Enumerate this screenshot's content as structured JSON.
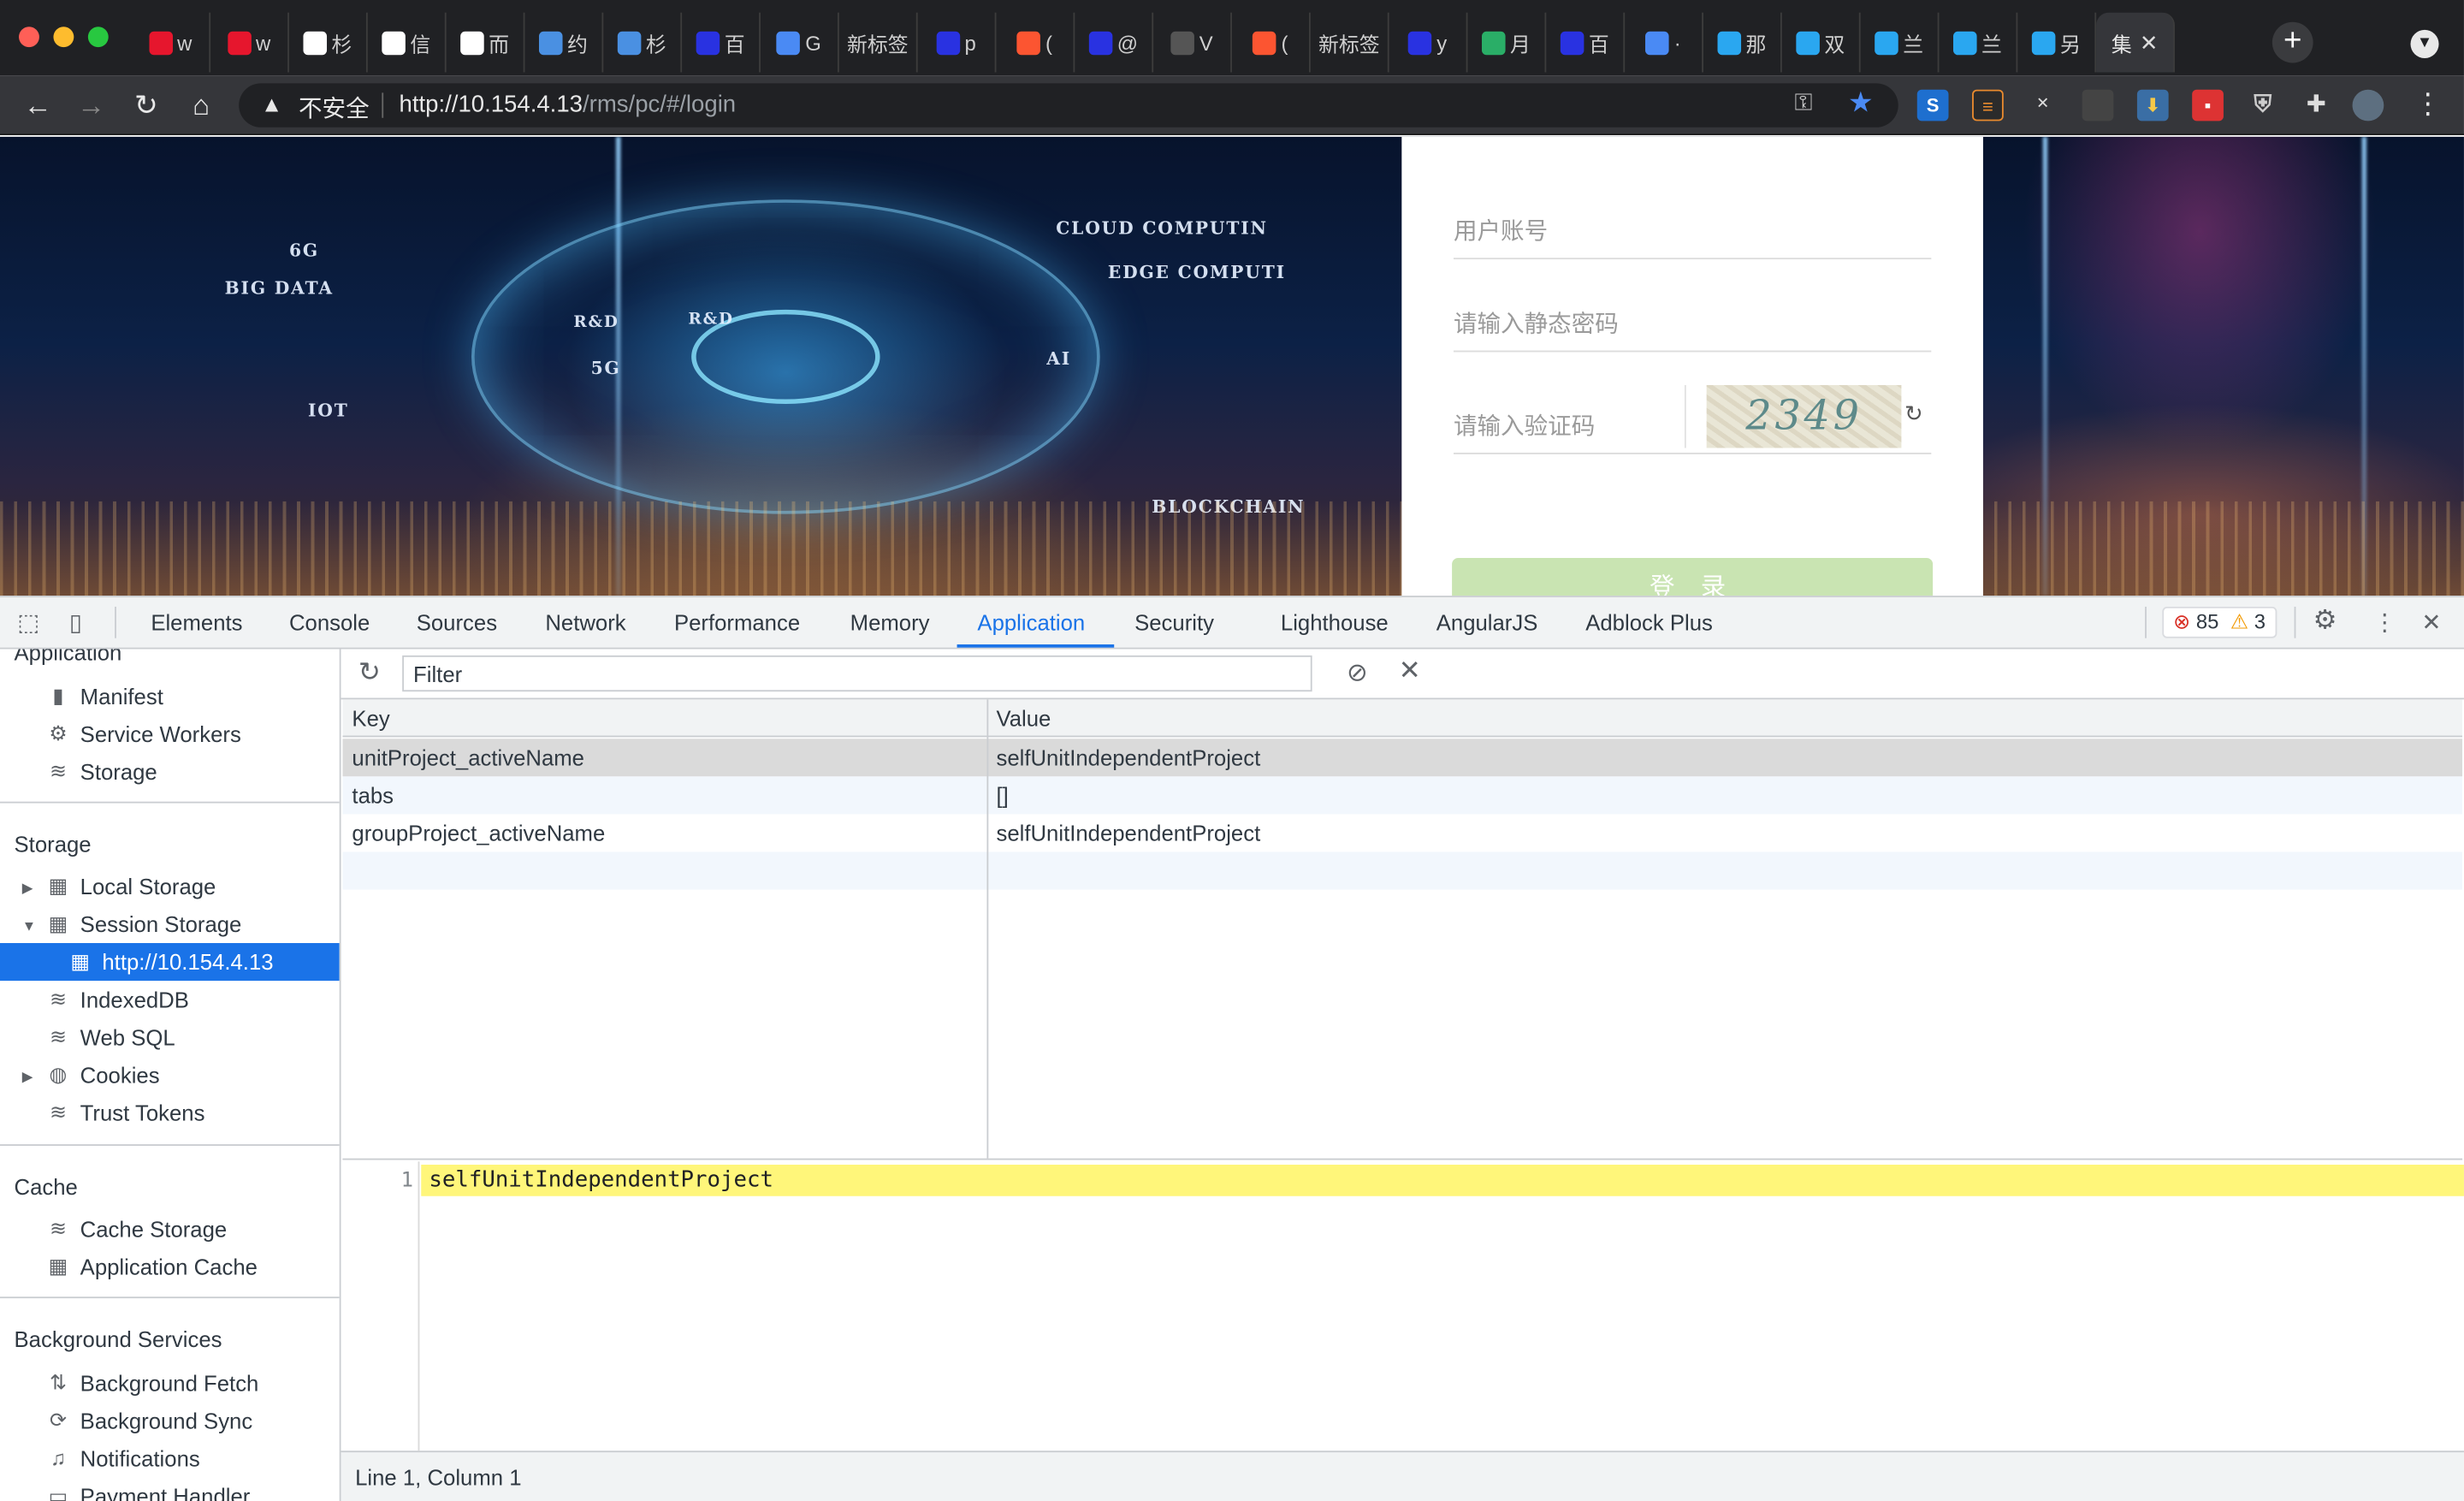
{
  "browser": {
    "tabs": [
      {
        "icon": "weibo-icon",
        "label": "w",
        "color": "#e6162d"
      },
      {
        "icon": "weibo-icon",
        "label": "w",
        "color": "#e6162d"
      },
      {
        "icon": "globe-icon",
        "label": "杉",
        "color": "#ffffff"
      },
      {
        "icon": "globe-icon",
        "label": "信",
        "color": "#ffffff"
      },
      {
        "icon": "globe-icon",
        "label": "而",
        "color": "#ffffff"
      },
      {
        "icon": "cube-icon",
        "label": "约",
        "color": "#4a90e2"
      },
      {
        "icon": "arrow-icon",
        "label": "杉",
        "color": "#4a90e2"
      },
      {
        "icon": "baidu-icon",
        "label": "百",
        "color": "#2932e1"
      },
      {
        "icon": "translate-icon",
        "label": "G",
        "color": "#4a8af4"
      },
      {
        "icon": "none",
        "label": "新标签",
        "color": ""
      },
      {
        "icon": "baidu-icon",
        "label": "p",
        "color": "#2932e1"
      },
      {
        "icon": "csdn-icon",
        "label": "(",
        "color": "#fc5531"
      },
      {
        "icon": "baidu-icon",
        "label": "@",
        "color": "#2932e1"
      },
      {
        "icon": "github-icon",
        "label": "V",
        "color": "#555555"
      },
      {
        "icon": "csdn-icon",
        "label": "(",
        "color": "#fc5531"
      },
      {
        "icon": "none",
        "label": "新标签",
        "color": ""
      },
      {
        "icon": "baidu-icon",
        "label": "y",
        "color": "#2932e1"
      },
      {
        "icon": "wechat-icon",
        "label": "月",
        "color": "#2aae67"
      },
      {
        "icon": "baidu-icon",
        "label": "百",
        "color": "#2932e1"
      },
      {
        "icon": "edge-icon",
        "label": "·",
        "color": "#4a8af4"
      },
      {
        "icon": "play-icon",
        "label": "那",
        "color": "#2aa7f0"
      },
      {
        "icon": "play-icon",
        "label": "双",
        "color": "#2aa7f0"
      },
      {
        "icon": "play-icon",
        "label": "兰",
        "color": "#2aa7f0"
      },
      {
        "icon": "play-icon",
        "label": "兰",
        "color": "#2aa7f0"
      },
      {
        "icon": "play-icon",
        "label": "另",
        "color": "#2aa7f0"
      },
      {
        "icon": "none",
        "label": "集",
        "color": "",
        "active": true
      }
    ],
    "insecure_label": "不安全",
    "url_host": "http://10.154.4.13",
    "url_path": "/rms/pc/#/login"
  },
  "login": {
    "username_placeholder": "用户账号",
    "password_placeholder": "请输入静态密码",
    "captcha_placeholder": "请输入验证码",
    "captcha_text": "2349",
    "login_button": "登 录",
    "tech_labels": {
      "6g": "6G",
      "big_data": "BIG DATA",
      "cloud": "CLOUD COMPUTIN",
      "edge": "EDGE COMPUTI",
      "5g": "5G",
      "ai": "AI",
      "iot": "IOT",
      "blockchain": "BLOCKCHAIN",
      "rd1": "R&D",
      "rd2": "R&D"
    }
  },
  "devtools": {
    "tabs": [
      "Elements",
      "Console",
      "Sources",
      "Network",
      "Performance",
      "Memory",
      "Application",
      "Security",
      "Lighthouse",
      "AngularJS",
      "Adblock Plus"
    ],
    "active_tab": "Application",
    "errors": "85",
    "warnings": "3",
    "sidebar": {
      "application_header": "Application",
      "application_items": [
        "Manifest",
        "Service Workers",
        "Storage"
      ],
      "storage_header": "Storage",
      "storage_items": [
        "Local Storage",
        "Session Storage",
        "http://10.154.4.13",
        "IndexedDB",
        "Web SQL",
        "Cookies",
        "Trust Tokens"
      ],
      "cache_header": "Cache",
      "cache_items": [
        "Cache Storage",
        "Application Cache"
      ],
      "background_header": "Background Services",
      "background_items": [
        "Background Fetch",
        "Background Sync",
        "Notifications",
        "Payment Handler"
      ]
    },
    "filter_placeholder": "Filter",
    "table": {
      "key_header": "Key",
      "value_header": "Value",
      "rows": [
        {
          "key": "unitProject_activeName",
          "value": "selfUnitIndependentProject"
        },
        {
          "key": "tabs",
          "value": "[]"
        },
        {
          "key": "groupProject_activeName",
          "value": "selfUnitIndependentProject"
        }
      ]
    },
    "preview": {
      "line_number": "1",
      "text": "selfUnitIndependentProject"
    },
    "status": "Line 1, Column 1"
  }
}
